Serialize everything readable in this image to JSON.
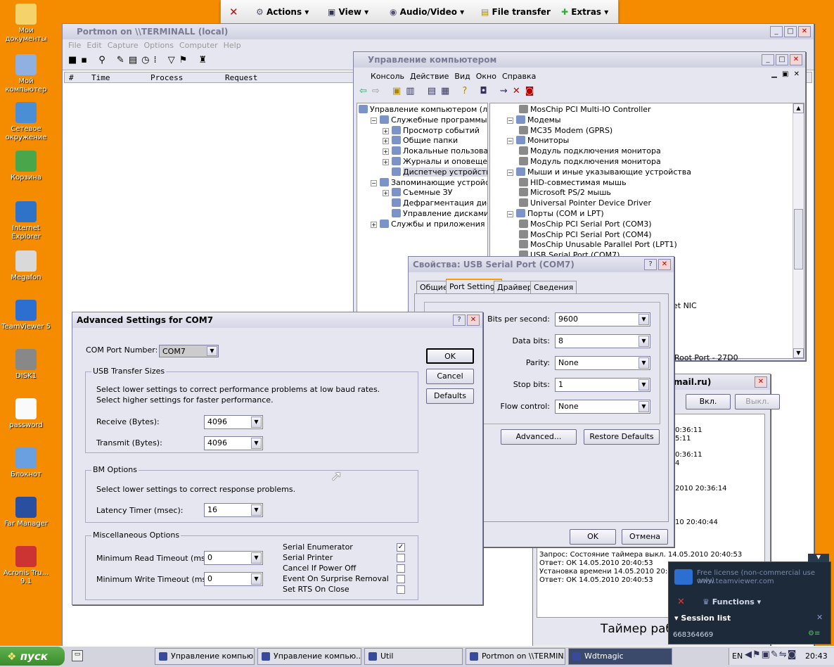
{
  "desktop_icons": [
    {
      "label": "Мои документы",
      "icon": "folder-documents-icon"
    },
    {
      "label": "Мой компьютер",
      "icon": "computer-icon"
    },
    {
      "label": "Сетевое окружение",
      "icon": "network-icon"
    },
    {
      "label": "Корзина",
      "icon": "recycle-bin-icon"
    },
    {
      "label": "Internet Explorer",
      "icon": "ie-icon"
    },
    {
      "label": "Megafon",
      "icon": "megafon-icon"
    },
    {
      "label": "TeamViewer 5",
      "icon": "teamviewer-icon"
    },
    {
      "label": "DISK1",
      "icon": "disk-icon"
    },
    {
      "label": "password",
      "icon": "text-file-icon"
    },
    {
      "label": "Блокнот",
      "icon": "notepad-icon"
    },
    {
      "label": "Far Manager",
      "icon": "far-icon"
    },
    {
      "label": "Acronis Tru... 9.1",
      "icon": "acronis-icon"
    }
  ],
  "tv_toolbar": {
    "actions": "Actions",
    "view": "View",
    "audio": "Audio/Video",
    "file": "File transfer",
    "extras": "Extras"
  },
  "portmon": {
    "title": "Portmon on \\\\TERMINALL (local)",
    "menu": [
      "File",
      "Edit",
      "Capture",
      "Options",
      "Computer",
      "Help"
    ],
    "columns": [
      "#",
      "Time",
      "Process",
      "Request"
    ]
  },
  "compmgmt": {
    "title": "Управление компьютером",
    "menu": [
      "Консоль",
      "Действие",
      "Вид",
      "Окно",
      "Справка"
    ],
    "tree": [
      "Управление компьютером (локаль",
      "Служебные программы",
      "Просмотр событий",
      "Общие папки",
      "Локальные пользователи и",
      "Журналы и оповещения пр",
      "Диспетчер устройств",
      "Запоминающие устройства",
      "Съемные ЗУ",
      "Дефрагментация диска",
      "Управление дисками",
      "Службы и приложения"
    ],
    "devices": [
      "MosChip PCI Multi-IO Controller",
      "Модемы",
      "MC35 Modem (GPRS)",
      "Мониторы",
      "Модуль подключения монитора",
      "Модуль подключения монитора",
      "Мыши и иные указывающие устройства",
      "HID-совместимая мышь",
      "Microsoft PS/2 мышь",
      "Universal Pointer Device Driver",
      "Порты (COM и LPT)",
      "MosChip PCI Serial Port (COM3)",
      "MosChip PCI Serial Port (COM4)",
      "MosChip Unusable Parallel Port (LPT1)",
      "USB Serial Port (COM7)"
    ],
    "partial1": "et NIC",
    "partial2": "Root Port - 27D0"
  },
  "props": {
    "title": "Свойства: USB Serial Port (COM7)",
    "tabs": [
      "Общие",
      "Port Settings",
      "Драйвер",
      "Сведения"
    ],
    "fields": [
      {
        "label": "Bits per second:",
        "value": "9600"
      },
      {
        "label": "Data bits:",
        "value": "8"
      },
      {
        "label": "Parity:",
        "value": "None"
      },
      {
        "label": "Stop bits:",
        "value": "1"
      },
      {
        "label": "Flow control:",
        "value": "None"
      }
    ],
    "advanced": "Advanced...",
    "restore": "Restore Defaults",
    "ok": "OK",
    "cancel": "Отмена"
  },
  "bgwin": {
    "title": "mail.ru)",
    "on": "Вкл.",
    "off": "Выкл.",
    "log_partial": [
      "0:36:11",
      "5:11",
      "0:36:11",
      "4",
      "2010 20:36:14",
      "10 20:40:44"
    ],
    "log": [
      "Запрос: Состояние таймера выкл. 14.05.2010 20:40:53",
      "Ответ: ОК 14.05.2010 20:40:53",
      "Установка времени 14.05.2010 20:40:53",
      "Ответ: ОК 14.05.2010 20:40:53"
    ],
    "footer": "Таймер раб"
  },
  "adv": {
    "title": "Advanced Settings for COM7",
    "com_label": "COM Port Number:",
    "com_value": "COM7",
    "ok": "OK",
    "cancel": "Cancel",
    "defaults": "Defaults",
    "usb_group": "USB Transfer Sizes",
    "usb_text1": "Select lower settings to correct performance problems at low baud rates.",
    "usb_text2": "Select higher settings for faster performance.",
    "receive_label": "Receive (Bytes):",
    "receive": "4096",
    "transmit_label": "Transmit (Bytes):",
    "transmit": "4096",
    "bm_group": "BM Options",
    "bm_text": "Select lower settings to correct response problems.",
    "latency_label": "Latency Timer (msec):",
    "latency": "16",
    "misc_group": "Miscellaneous Options",
    "minread_label": "Minimum Read Timeout (msec):",
    "minread": "0",
    "minwrite_label": "Minimum Write Timeout (msec):",
    "minwrite": "0",
    "checks": [
      {
        "label": "Serial Enumerator",
        "checked": true
      },
      {
        "label": "Serial Printer",
        "checked": false
      },
      {
        "label": "Cancel If Power Off",
        "checked": false
      },
      {
        "label": "Event On Surprise Removal",
        "checked": false
      },
      {
        "label": "Set RTS On Close",
        "checked": false
      }
    ]
  },
  "tvpanel": {
    "url1": "Free license (non-commercial use only)",
    "url2": "www.teamviewer.com",
    "functions": "Functions",
    "session": "Session list",
    "id": "668364669"
  },
  "taskbar": {
    "start": "пуск",
    "tasks": [
      "Управление компью...",
      "Управление компью...",
      "Util",
      "Portmon on \\\\TERMIN...",
      "Wdtmagic"
    ],
    "lang": "EN",
    "clock": "20:43"
  }
}
